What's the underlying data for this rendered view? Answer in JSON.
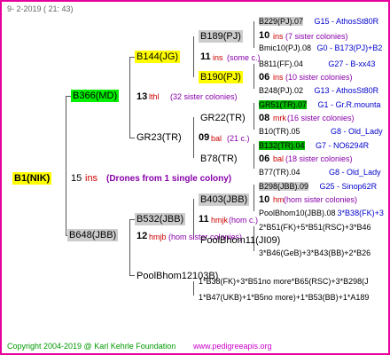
{
  "date": "9-  2-2019 (  21:  43)",
  "root": {
    "label": "B1(NIK)",
    "num": "15",
    "ins": "ins",
    "note": "(Drones from 1 single colony)"
  },
  "gen1": [
    {
      "label": "B366(MD)",
      "num": "13",
      "ins": "lthl",
      "note": "(32 sister colonies)"
    },
    {
      "label": "B648(JBB)",
      "num": "12",
      "ins": "hmjb",
      "note": "(hom sister colonies)"
    }
  ],
  "gen2": [
    {
      "label": "B144(JG)",
      "num": "11",
      "ins": "ins",
      "note": "(some c.)"
    },
    {
      "label": "GR23(TR)",
      "num": "09",
      "ins": "bal",
      "note": "(21 c.)"
    },
    {
      "label": "B532(JBB)",
      "num": "11",
      "ins": "hmjk",
      "note": "(hom c.)"
    },
    {
      "label": "PoolBhom12103B)"
    }
  ],
  "gen3": [
    {
      "label": "B189(PJ)",
      "num": "10",
      "ins": "ins",
      "note": "(7 sister colonies)"
    },
    {
      "label": "B190(PJ)",
      "num": "06",
      "ins": "ins",
      "note": "(10 sister colonies)"
    },
    {
      "label": "GR22(TR)",
      "num": "08",
      "ins": "mrk",
      "note": "(16 sister colonies)"
    },
    {
      "label": "B78(TR)",
      "num": "06",
      "ins": "bal",
      "note": "(18 sister colonies)"
    },
    {
      "label": "B403(JBB)",
      "num": "10",
      "ins": "hm",
      "note": "(hom sister colonies)"
    },
    {
      "label": "PoolBhom11(JI09)"
    }
  ],
  "gen4": [
    {
      "label": "B229(PJ).07",
      "right": "G15 - AthosSt80R"
    },
    {
      "label": "Bmic10(PJ).08",
      "right": "G0 - B173(PJ)+B2"
    },
    {
      "label": "B811(FF).04",
      "right": "G27 - B-xx43"
    },
    {
      "label": "B248(PJ).02",
      "right": "G13 - AthosSt80R"
    },
    {
      "label": "GR51(TR).07",
      "right": "G1 - Gr.R.mounta"
    },
    {
      "label": "B10(TR).05",
      "right": "G8 - Old_Lady"
    },
    {
      "label": "B132(TR).04",
      "right": "G7 - NO6294R"
    },
    {
      "label": "B77(TR).04",
      "right": "G8 - Old_Lady"
    },
    {
      "label": "B298(JBB).09",
      "right": "G25 - Sinop62R"
    },
    {
      "label": "PoolBhom10(JBB).08",
      "right": "3*B38(FK)+3"
    },
    {
      "label": "2*B51(FK)+5*B51(RSC)+3*B46"
    },
    {
      "label": "3*B46(GeB)+3*B43(BB)+2*B26"
    },
    {
      "label": "1*B38(FK)+3*B51no more*B65(RSC)+3*B298(J"
    },
    {
      "label": "1*B47(UKB)+1*B5no more)+1*B53(BB)+1*A189"
    }
  ],
  "footer": {
    "copyright": "Copyright 2004-2019 @ Karl Kehrle Foundation",
    "site": "www.pedigreeapis.org"
  },
  "colors": {
    "border": "#e8009e",
    "green": "#00ee00",
    "yellow": "#ffff00",
    "gray": "#cccccc"
  }
}
